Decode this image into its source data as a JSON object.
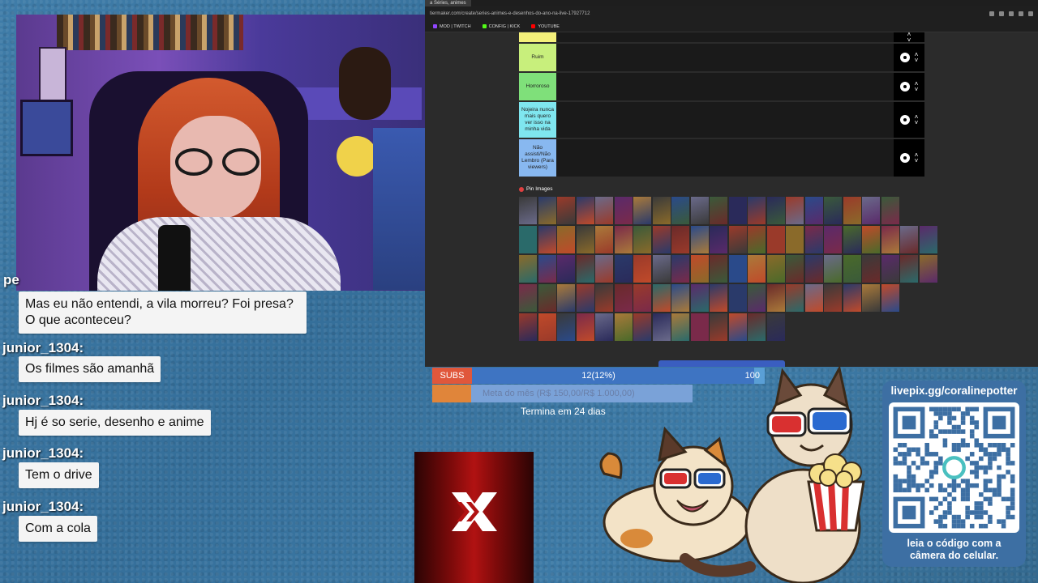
{
  "browser": {
    "tab_title": "a Séries, animes",
    "url": "tiermaker.com/create/series-animes-e-desenhos-do-ano-na-live-17927712",
    "bookmarks": [
      {
        "label": "MOD | TWITCH",
        "color": "#9146ff"
      },
      {
        "label": "CONFIG | KICK",
        "color": "#53fc18"
      },
      {
        "label": "YOUTUBE",
        "color": "#ff0000"
      }
    ],
    "pin_label": "Pin Images",
    "tiers": [
      {
        "label": "",
        "color": "#f4f07a"
      },
      {
        "label": "Ruim",
        "color": "#c8ef7c"
      },
      {
        "label": "Horroroso",
        "color": "#7fe07a"
      },
      {
        "label": "Nojeira nunca mais quero ver isso na minha vida",
        "color": "#7fe6ef"
      },
      {
        "label": "Não assisti/Não Lembro (Para viewers)",
        "color": "#88b8f0"
      }
    ]
  },
  "chat": {
    "partial_name": "pe",
    "messages": [
      {
        "user": "",
        "text": "Mas eu não entendi, a vila morreu? Foi presa? O que aconteceu?"
      },
      {
        "user": "junior_1304:",
        "text": "Os filmes são amanhã"
      },
      {
        "user": "junior_1304:",
        "text": "Hj é so serie, desenho e anime"
      },
      {
        "user": "junior_1304:",
        "text": "Tem o drive"
      },
      {
        "user": "junior_1304:",
        "text": "Com a cola"
      }
    ]
  },
  "subs": {
    "tag": "SUBS",
    "count": "12(12%)",
    "goal": "100",
    "progress": 0.12
  },
  "meta": {
    "text": "Meta do mês (R$ 150,00/R$ 1.000,00)",
    "progress": 0.15
  },
  "ends_text": "Termina em 24 dias",
  "qr": {
    "url": "livepix.gg/coralinepotter",
    "caption_line1": "leia o código com a",
    "caption_line2": "câmera do celular."
  },
  "colors": {
    "background": "#3a75a0",
    "accent_orange": "#e0573b",
    "bar_blue": "#3e74c2"
  }
}
